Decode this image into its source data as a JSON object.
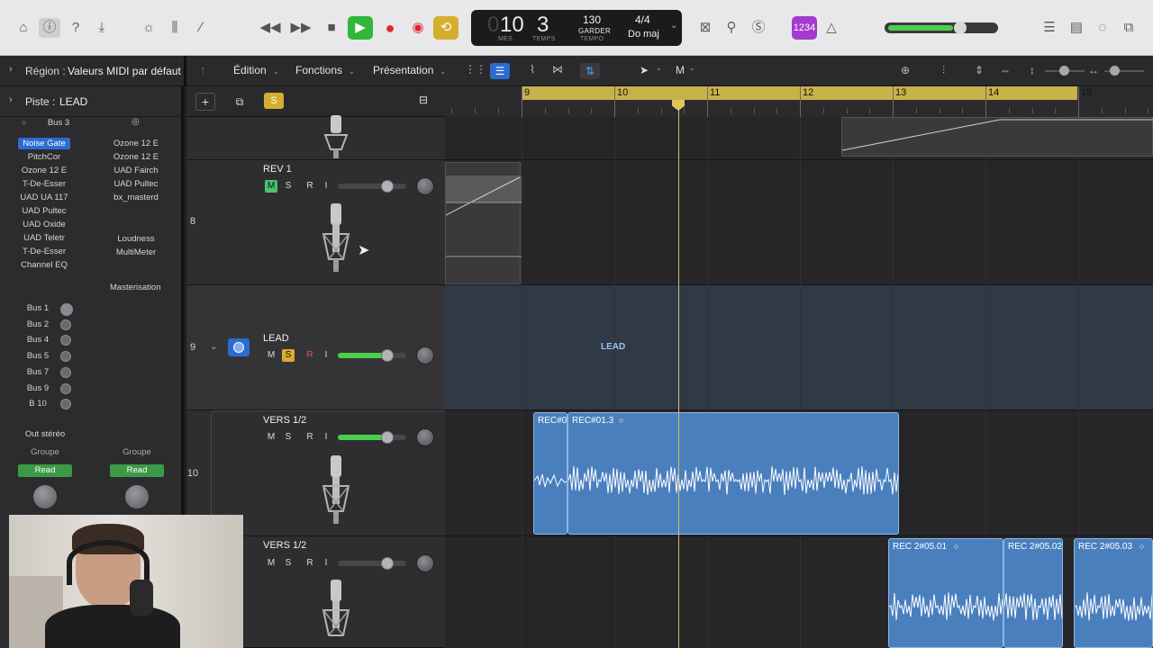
{
  "transport": {
    "measure": "10",
    "beat": "3",
    "measure_caption": "MES",
    "beat_caption": "TEMPS",
    "tempo": "130",
    "tempo_mode": "GARDER",
    "tempo_caption": "TEMPO",
    "signature": "4/4",
    "key": "Do maj",
    "count_in": "1234"
  },
  "toolbar2": {
    "edit_menu": "Édition",
    "functions_menu": "Fonctions",
    "view_menu": "Présentation",
    "tool_m": "M"
  },
  "inspector": {
    "region_prefix": "Région :",
    "region_value": "Valeurs MIDI par défaut",
    "track_prefix": "Piste :",
    "track_value": "LEAD",
    "left_bus_top": "Bus 3",
    "left_plugins": [
      "Noise Gate",
      "PitchCor",
      "Ozone 12 E",
      "T-De-Esser",
      "UAD UA 117",
      "UAD Pultec",
      "UAD Oxide",
      "UAD Teletr",
      "T-De-Esser",
      "Channel EQ"
    ],
    "right_plugins": [
      "Ozone 12 E",
      "Ozone 12 E",
      "UAD Fairch",
      "UAD Pultec",
      "bx_masterd",
      "",
      "Loudness",
      "MultiMeter"
    ],
    "right_strip_name": "Masterisation",
    "sends": [
      "Bus 1",
      "Bus 2",
      "Bus 4",
      "Bus 5",
      "Bus 7",
      "Bus 9",
      "B 10"
    ],
    "output": "Out stéréo",
    "group_left": "Groupe",
    "group_right": "Groupe",
    "automation_left": "Read",
    "automation_right": "Read"
  },
  "tracks": [
    {
      "number": "8",
      "name": "REV 1",
      "m": "M",
      "s": "S",
      "r": "R",
      "i": "I"
    },
    {
      "number": "9",
      "name": "LEAD",
      "m": "M",
      "s": "S",
      "r": "R",
      "i": "I"
    },
    {
      "number": "10",
      "name": "VERS 1/2",
      "m": "M",
      "s": "S",
      "r": "R",
      "i": "I"
    },
    {
      "number": "",
      "name": "VERS 1/2",
      "m": "M",
      "s": "S",
      "r": "R",
      "i": "I"
    }
  ],
  "ruler": [
    "9",
    "10",
    "11",
    "12",
    "13",
    "14",
    "15"
  ],
  "regions": {
    "lead_folder": "LEAD",
    "rec_a": "REC#0",
    "rec_b": "REC#01.3",
    "rec2_1": "REC 2#05.01",
    "rec2_2": "REC 2#05.02",
    "rec2_3": "REC 2#05.03"
  },
  "colors": {
    "play_green": "#2fb83a",
    "record_red": "#e0282c",
    "cycle_yellow": "#c7b24a",
    "region_blue": "#4a7fbe",
    "selection_blue": "#2c6bd0",
    "solo_yellow": "#d6ae2e"
  }
}
